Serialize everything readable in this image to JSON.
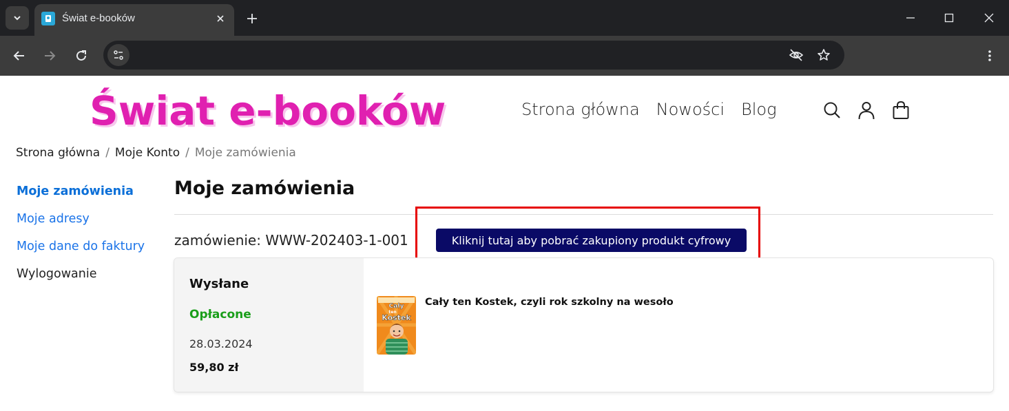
{
  "browser": {
    "tab_title": "Świat e-booków",
    "url": ""
  },
  "site": {
    "logo": "Świat e-booków",
    "nav": [
      "Strona główna",
      "Nowości",
      "Blog"
    ],
    "colors": {
      "logo": "#e020b0",
      "link": "#1a73e8",
      "button": "#0a0a66",
      "paid": "#1a9e1a",
      "highlight": "#e60000"
    }
  },
  "breadcrumb": [
    "Strona główna",
    "Moje Konto",
    "Moje zamówienia"
  ],
  "sidebar": {
    "items": [
      "Moje zamówienia",
      "Moje adresy",
      "Moje dane do faktury",
      "Wylogowanie"
    ]
  },
  "page": {
    "title": "Moje zamówienia"
  },
  "order": {
    "label": "zamówienie: WWW-202403-1-001",
    "download_button": "Kliknij tutaj aby pobrać zakupiony produkt cyfrowy",
    "status": "Wysłane",
    "payment": "Opłacone",
    "date": "28.03.2024",
    "total": "59,80 zł",
    "product": {
      "title": "Cały ten Kostek, czyli rok szkolny na wesoło",
      "cover_text": [
        "Cały",
        "ten",
        "Kostek"
      ]
    }
  }
}
